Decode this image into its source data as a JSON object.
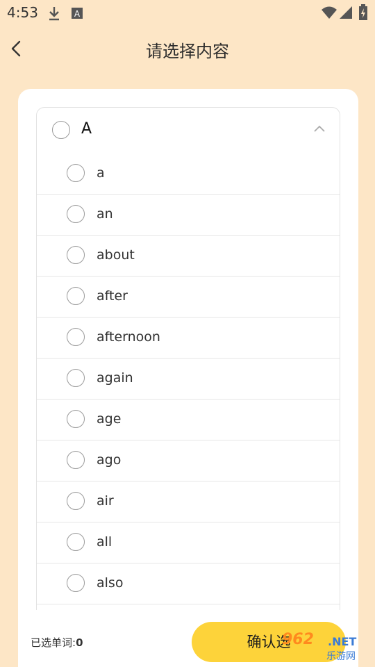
{
  "status_bar": {
    "time": "4:53",
    "icons": [
      "download-icon",
      "font-badge-icon",
      "wifi-icon",
      "signal-icon",
      "battery-charging-icon"
    ]
  },
  "header": {
    "title": "请选择内容",
    "back_icon": "chevron-left-icon"
  },
  "group": {
    "letter": "A",
    "expanded": true,
    "collapse_icon": "chevron-up-icon"
  },
  "words": [
    {
      "label": "a"
    },
    {
      "label": "an"
    },
    {
      "label": "about"
    },
    {
      "label": "after"
    },
    {
      "label": "afternoon"
    },
    {
      "label": "again"
    },
    {
      "label": "age"
    },
    {
      "label": "ago"
    },
    {
      "label": "air"
    },
    {
      "label": "all"
    },
    {
      "label": "also"
    }
  ],
  "footer": {
    "selected_label": "已选单词:",
    "selected_count": "0",
    "confirm_label": "确认选"
  },
  "watermark": {
    "main": "962",
    "net": ".NET",
    "sub": "乐游网"
  },
  "colors": {
    "background": "#fde6c6",
    "card": "#ffffff",
    "accent": "#fdd33a",
    "watermark_orange": "#ff8a1e",
    "watermark_blue": "#3a7bd5"
  }
}
